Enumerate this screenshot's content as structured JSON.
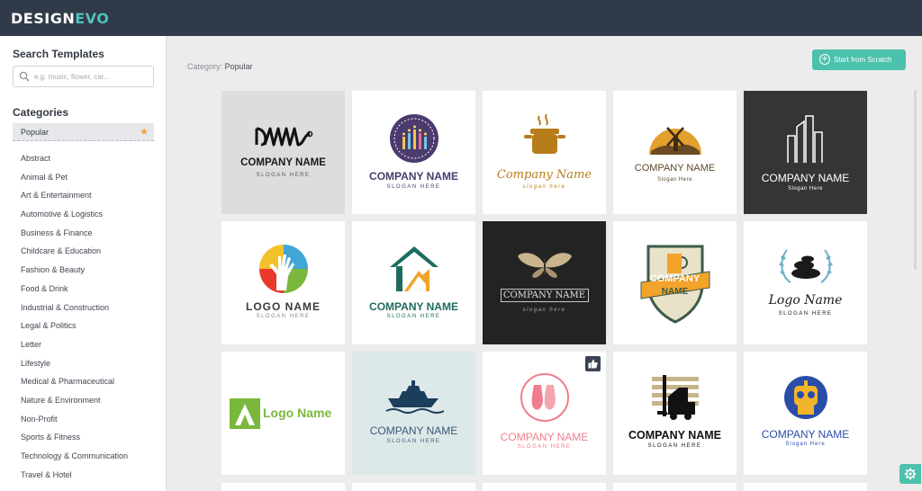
{
  "app": {
    "logo_main": "DESIGN",
    "logo_accent": "EVO"
  },
  "sidebar": {
    "search_title": "Search Templates",
    "search_placeholder": "e.g. music, flower, car...",
    "categories_title": "Categories",
    "selected_category": "Popular",
    "categories": [
      "Abstract",
      "Animal & Pet",
      "Art & Entertainment",
      "Automotive & Logistics",
      "Business & Finance",
      "Childcare & Education",
      "Fashion & Beauty",
      "Food & Drink",
      "Industrial & Construction",
      "Legal & Politics",
      "Letter",
      "Lifestyle",
      "Medical & Pharmaceutical",
      "Nature & Environment",
      "Non-Profit",
      "Sports & Fitness",
      "Technology & Communication",
      "Travel & Hotel"
    ]
  },
  "main": {
    "category_label": "Category:",
    "category_value": "Popular",
    "start_button": "Start from Scratch"
  },
  "templates": [
    {
      "name": "COMPANY NAME",
      "slogan": "SLOGAN HERE",
      "icon": "squiggle-icon",
      "bg": "#dcdddc"
    },
    {
      "name": "COMPANY NAME",
      "slogan": "SLOGAN HERE",
      "icon": "candles-badge-icon",
      "bg": "#ffffff"
    },
    {
      "name": "Company Name",
      "slogan": "slogan here",
      "icon": "cooking-pot-icon",
      "bg": "#ffffff"
    },
    {
      "name": "COMPANY NAME",
      "slogan": "Slogan Here",
      "icon": "windmill-icon",
      "bg": "#ffffff"
    },
    {
      "name": "COMPANY NAME",
      "slogan": "Slogan Here",
      "icon": "buildings-icon",
      "bg": "#353535"
    },
    {
      "name": "LOGO NAME",
      "slogan": "SLOGAN HERE",
      "icon": "hand-circle-icon",
      "bg": "#ffffff"
    },
    {
      "name": "COMPANY NAME",
      "slogan": "SLOGAN HERE",
      "icon": "house-icon",
      "bg": "#ffffff"
    },
    {
      "name": "COMPANY NAME",
      "slogan": "slogan here",
      "icon": "butterfly-icon",
      "bg": "#232323"
    },
    {
      "name_line1": "COMPANY",
      "name_line2": "NAME",
      "icon": "shield-beer-icon",
      "bg": "#ffffff"
    },
    {
      "name": "Logo Name",
      "slogan": "SLOGAN HERE",
      "icon": "stones-laurel-icon",
      "bg": "#ffffff"
    },
    {
      "name": "Logo Name",
      "icon": "letter-a-icon",
      "bg": "#ffffff"
    },
    {
      "name": "COMPANY NAME",
      "slogan": "SLOGAN HERE",
      "icon": "cruise-ship-icon",
      "bg": "#dde8e8"
    },
    {
      "name": "COMPANY NAME",
      "slogan": "SLOGAN HERE",
      "icon": "ballet-shoes-icon",
      "bg": "#ffffff"
    },
    {
      "name": "COMPANY NAME",
      "slogan": "SLOGAN HERE",
      "icon": "forklift-icon",
      "bg": "#ffffff"
    },
    {
      "name": "COMPANY NAME",
      "slogan": "Slogan Here",
      "icon": "robot-icon",
      "bg": "#ffffff"
    }
  ],
  "colors": {
    "topbar": "#303a48",
    "accent": "#4cc1ad",
    "star": "#f2a333"
  }
}
